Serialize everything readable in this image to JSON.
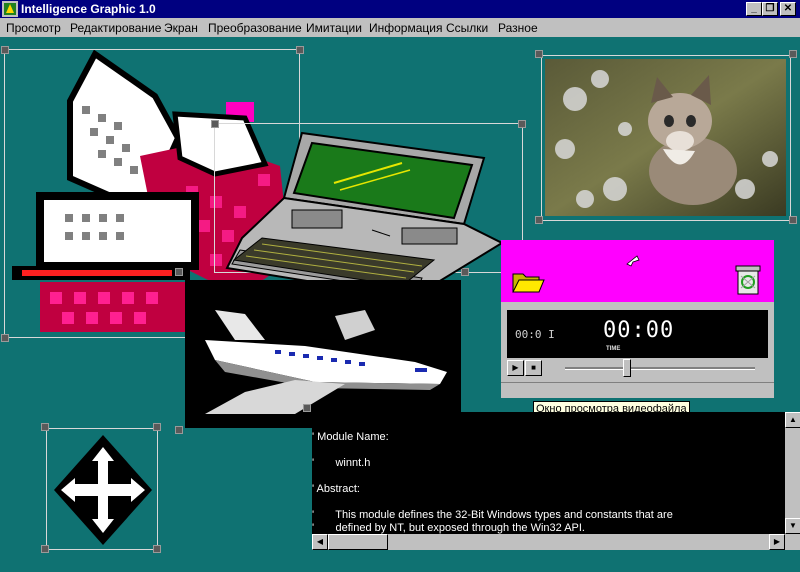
{
  "window": {
    "title": "Intelligence Graphic 1.0",
    "min_glyph": "_",
    "restore_glyph": "❐",
    "close_glyph": "✕"
  },
  "menu": {
    "items": [
      "Просмотр",
      "Редактирование",
      "Экран",
      "Преобразование",
      "Имитации",
      "Информация",
      "Ссылки",
      "Разное"
    ]
  },
  "video_player": {
    "counter": "00:0 I",
    "time": "00:00",
    "time_label": "TIME",
    "play_glyph": "▶",
    "stop_glyph": "■",
    "position_fraction": 0.32,
    "tooltip": "Окно просмотра видеофайла"
  },
  "code_window": {
    "lines": [
      "' Module Name:",
      "'       winnt.h",
      "' Abstract:",
      "'       This module defines the 32-Bit Windows types and constants that are",
      "'       defined by NT, but exposed through the Win32 API."
    ]
  },
  "colors": {
    "workspace": "#0f7272",
    "title_bar": "#000080",
    "player_panel": "#ff00ff",
    "chrome": "#c0c0c0"
  },
  "icons": {
    "app": "app-logo-icon",
    "printer": "printer-icon",
    "laptop": "laptop-icon",
    "airplane": "airplane-icon",
    "kitten": "kitten-photo",
    "move": "move-arrows-icon",
    "folder": "folder-icon",
    "recycle_bin": "recycle-bin-icon"
  }
}
